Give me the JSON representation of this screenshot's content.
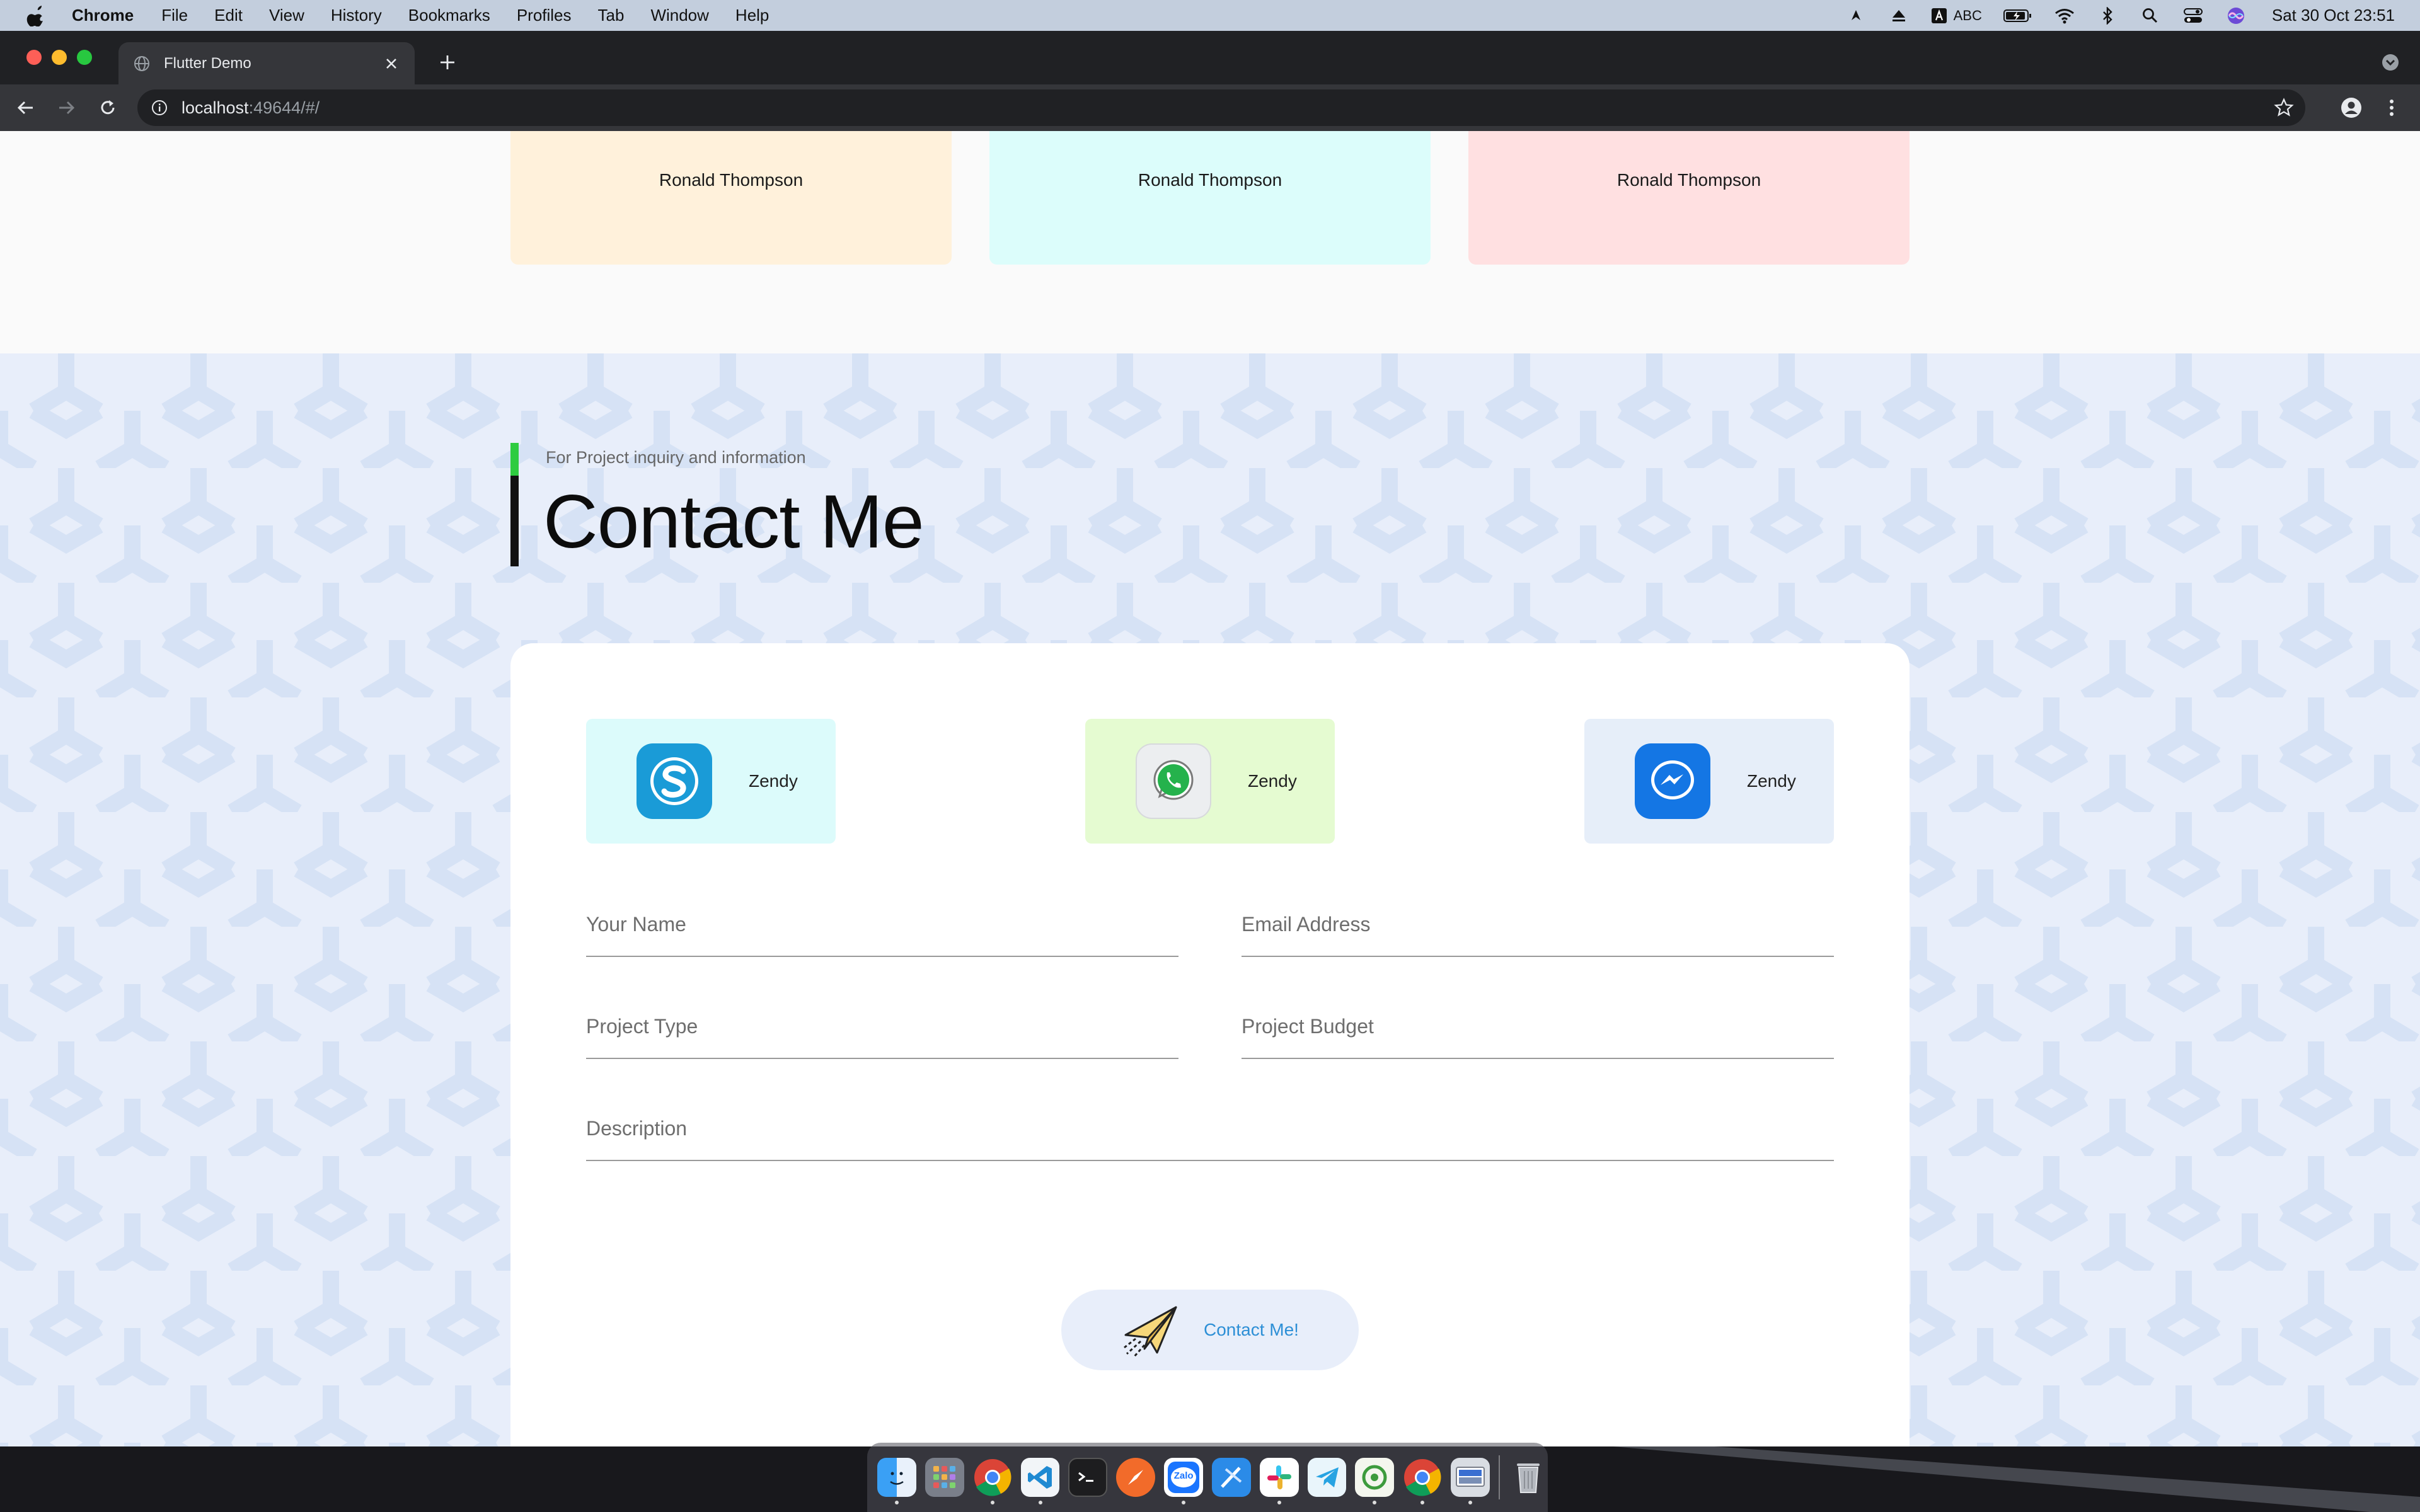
{
  "menubar": {
    "app": "Chrome",
    "items": [
      "File",
      "Edit",
      "View",
      "History",
      "Bookmarks",
      "Profiles",
      "Tab",
      "Window",
      "Help"
    ],
    "input_source": "ABC",
    "clock": "Sat 30 Oct  23:51"
  },
  "browser": {
    "tab_title": "Flutter Demo",
    "url_host": "localhost",
    "url_rest": ":49644/#/"
  },
  "team": {
    "cards": [
      {
        "name": "Ronald Thompson",
        "color": "#fff1db"
      },
      {
        "name": "Ronald Thompson",
        "color": "#dcfdfb"
      },
      {
        "name": "Ronald Thompson",
        "color": "#ffe0e1"
      }
    ]
  },
  "contact": {
    "subtitle": "For Project inquiry and information",
    "title": "Contact Me",
    "socials": [
      {
        "icon": "skype-icon",
        "label": "Zendy",
        "color": "#dcfbfb"
      },
      {
        "icon": "whatsapp-icon",
        "label": "Zendy",
        "color": "#e5fbd1"
      },
      {
        "icon": "messenger-icon",
        "label": "Zendy",
        "color": "#e6eef9"
      }
    ],
    "fields": {
      "name": "Your Name",
      "email": "Email Address",
      "project_type": "Project Type",
      "budget": "Project Budget",
      "description": "Description"
    },
    "button": "Contact Me!"
  },
  "dock": {
    "apps": [
      "finder-icon",
      "launchpad-icon",
      "chrome-icon",
      "vscode-icon",
      "terminal-icon",
      "compass-icon",
      "zalo-icon",
      "xcode-icon",
      "slack-icon",
      "telegram-icon",
      "dev-app-icon",
      "chrome-icon",
      "preview-icon",
      "trash-icon"
    ],
    "zalo_label": "Zalo"
  }
}
